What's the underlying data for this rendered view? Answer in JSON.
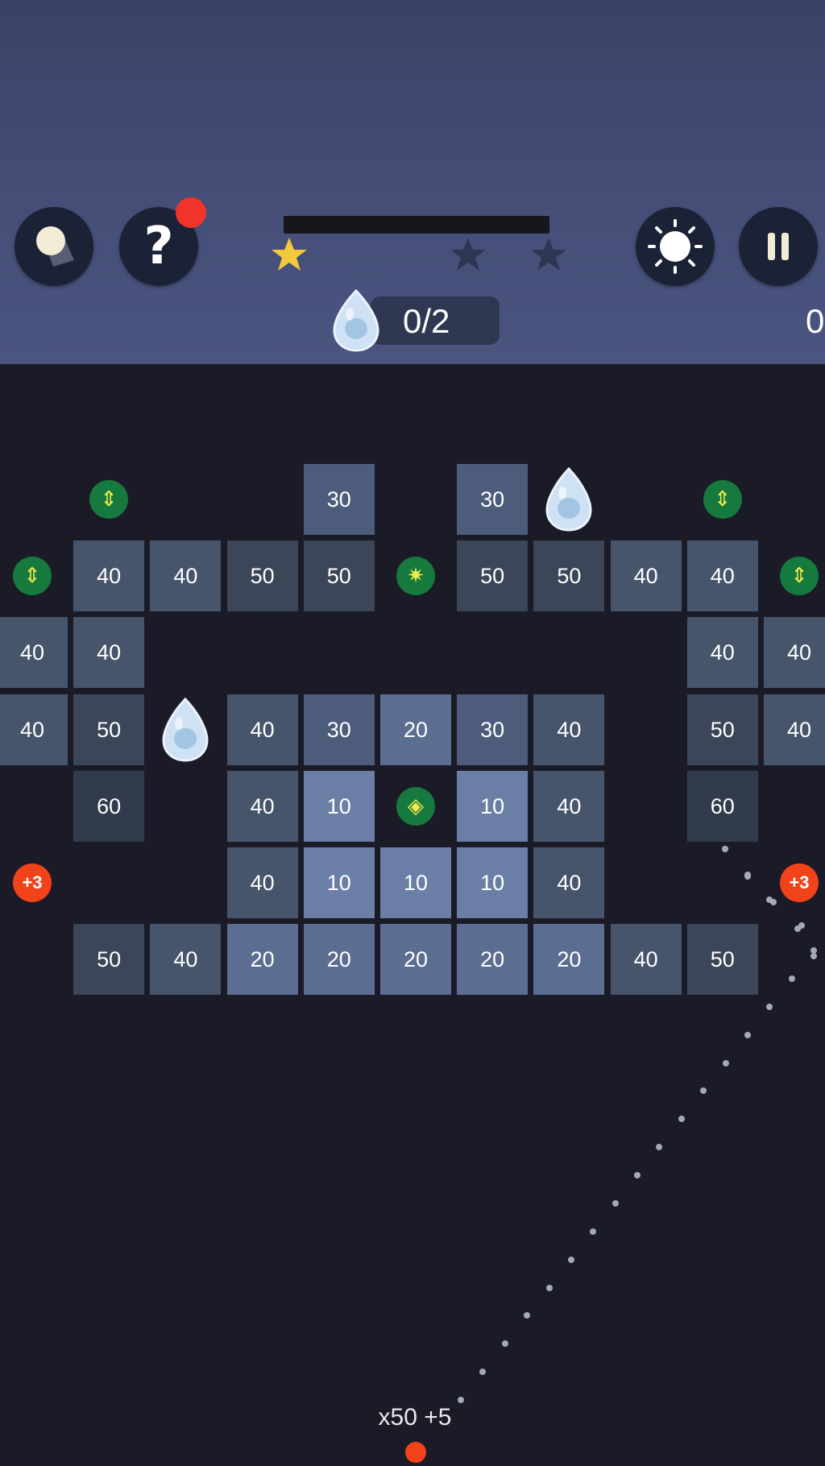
{
  "colors": {
    "header_bg": "#454f78",
    "board_bg": "#1a1b27",
    "star_gold": "#f3c83a",
    "star_dim": "#2e3654",
    "bonus_green": "#167a3e",
    "accent_red": "#f2421a"
  },
  "header": {
    "buttons": [
      {
        "name": "ball-skin-button",
        "icon": "ball-icon"
      },
      {
        "name": "help-button",
        "icon": "question-icon",
        "glyph": "?",
        "has_notification": true
      },
      {
        "name": "brightness-button",
        "icon": "sun-icon"
      },
      {
        "name": "pause-button",
        "icon": "pause-icon"
      }
    ],
    "level_progress": 0,
    "stars_earned": [
      true,
      false,
      false
    ],
    "egg_counter": "0/2",
    "score": "0"
  },
  "board": {
    "rows": [
      [
        "",
        "",
        "",
        "",
        "30",
        "",
        "30",
        "",
        "",
        "",
        ""
      ],
      [
        "",
        "40",
        "40",
        "50",
        "50",
        "",
        "50",
        "50",
        "40",
        "40",
        ""
      ],
      [
        "40",
        "40",
        "",
        "",
        "",
        "",
        "",
        "",
        "",
        "40",
        "40"
      ],
      [
        "40",
        "50",
        "",
        "40",
        "30",
        "20",
        "30",
        "40",
        "",
        "50",
        "40"
      ],
      [
        "",
        "60",
        "",
        "40",
        "10",
        "",
        "10",
        "40",
        "",
        "60",
        ""
      ],
      [
        "",
        "",
        "",
        "40",
        "10",
        "10",
        "10",
        "40",
        "",
        "",
        ""
      ],
      [
        "",
        "50",
        "40",
        "20",
        "20",
        "20",
        "20",
        "20",
        "40",
        "50",
        ""
      ]
    ],
    "items": [
      {
        "type": "bonus",
        "icon": "vertical-laser-icon",
        "row": 0,
        "col": 1
      },
      {
        "type": "egg",
        "row": 0,
        "col": 7
      },
      {
        "type": "bonus",
        "icon": "vertical-laser-icon",
        "row": 0,
        "col": 9
      },
      {
        "type": "bonus",
        "icon": "vertical-laser-icon",
        "row": 1,
        "col": 0
      },
      {
        "type": "bonus",
        "icon": "burst-icon",
        "row": 1,
        "col": 5
      },
      {
        "type": "bonus",
        "icon": "vertical-laser-icon",
        "row": 1,
        "col": 10
      },
      {
        "type": "egg",
        "row": 3,
        "col": 2
      },
      {
        "type": "bonus",
        "icon": "cross-laser-icon",
        "row": 4,
        "col": 5
      },
      {
        "type": "plus",
        "label": "+3",
        "row": 5,
        "col": 0
      },
      {
        "type": "plus",
        "label": "+3",
        "row": 5,
        "col": 10
      }
    ]
  },
  "launcher": {
    "ball_label": "x50 +5"
  }
}
